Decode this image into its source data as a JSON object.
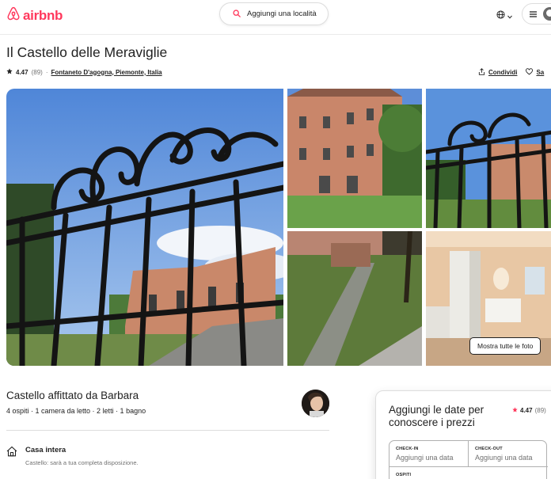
{
  "header": {
    "logo_text": "airbnb",
    "search_label": "Aggiungi una località",
    "brand_color": "#ff385c"
  },
  "listing": {
    "title": "Il Castello delle Meraviglie",
    "rating": "4.47",
    "reviews": "(89)",
    "separator": "·",
    "location": "Fontaneto D'agogna, Piemonte, Italia",
    "share_label": "Condividi",
    "save_label": "Sa"
  },
  "gallery": {
    "show_all_label": "Mostra tutte le foto"
  },
  "host": {
    "title": "Castello affittato da Barbara",
    "subtitle": "4 ospiti · 1 camera da letto · 2 letti · 1 bagno"
  },
  "features": [
    {
      "title": "Casa intera",
      "desc": "Castello: sarà a tua completa disposizione.",
      "icon": "home-icon"
    }
  ],
  "booking": {
    "title": "Aggiungi le date per conoscere i prezzi",
    "rating": "4.47",
    "reviews": "(89)",
    "checkin_label": "CHECK-IN",
    "checkin_value": "Aggiungi una data",
    "checkout_label": "CHECK-OUT",
    "checkout_value": "Aggiungi una data",
    "guests_label": "OSPITI"
  },
  "icons": {
    "logo": "airbnb-logo-icon",
    "search": "search-icon",
    "globe": "globe-icon",
    "menu": "hamburger-menu-icon",
    "avatar": "user-avatar-icon",
    "share": "share-icon",
    "save": "heart-icon",
    "star": "star-icon"
  }
}
